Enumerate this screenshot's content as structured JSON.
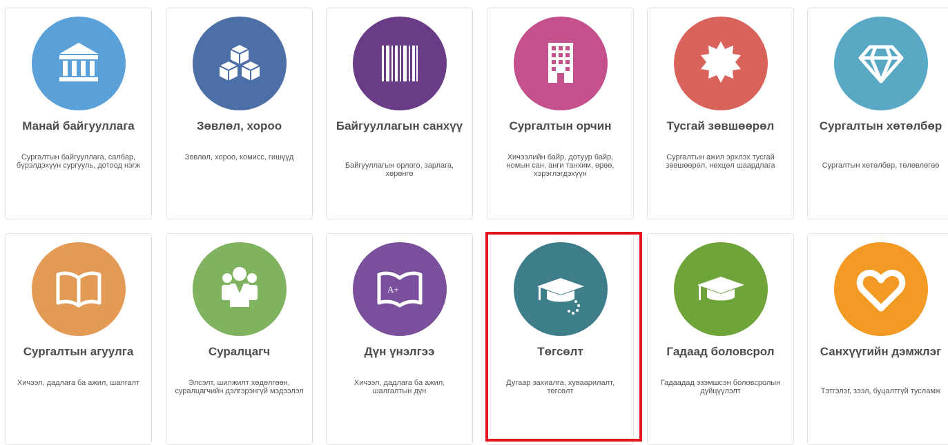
{
  "cards": [
    {
      "title": "Манай байгууллага",
      "desc": "Сургалтын байгууллага, салбар, бүрэлдэхүүн сургууль, дотоод нэгж",
      "icon": "bank-icon",
      "color": "#5aa1d9"
    },
    {
      "title": "Зөвлөл, хороо",
      "desc": "Зөвлөл, хороо, комисс, гишүүд",
      "icon": "cubes-icon",
      "color": "#4b6fa6"
    },
    {
      "title": "Байгууллагын санхүү",
      "desc": "Байгууллагын орлого, зарлага, хөрөнгө",
      "icon": "barcode-icon",
      "color": "#6a3b87"
    },
    {
      "title": "Сургалтын орчин",
      "desc": "Хичээлийн байр, дотуур байр, номын сан, анги танхим, өрөө, хэрэглэгдэхүүн",
      "icon": "building-icon",
      "color": "#c4508c"
    },
    {
      "title": "Тусгай зөвшөөрөл",
      "desc": "Сургалтын ажил эрхлэх тусгай зөвшөөрөл, нөхцөл шаардлага",
      "icon": "certificate-icon",
      "color": "#d9625a"
    },
    {
      "title": "Сургалтын хөтөлбөр",
      "desc": "Сургалтын хөтөлбөр, төлөвлөгөө",
      "icon": "diamond-icon",
      "color": "#5aa9c4"
    },
    {
      "title": "Сургалтын агуулга",
      "desc": "Хичээл, дадлага ба ажил, шалгалт",
      "icon": "book-icon",
      "color": "#e39a55"
    },
    {
      "title": "Суралцагч",
      "desc": "Элсэлт, шилжилт хөдөлгөөн, суралцагчийн дэлгэрэнгүй мэдээлэл",
      "icon": "users-icon",
      "color": "#7fb35f"
    },
    {
      "title": "Дүн үнэлгээ",
      "desc": "Хичээл, дадлага ба ажил, шалгалтын дүн",
      "icon": "grade-book-icon",
      "color": "#7a4f9c"
    },
    {
      "title": "Төгсөлт",
      "desc": "Дугаар захиалга, хуваарилалт, төгсөлт",
      "icon": "graduation-cap-icon",
      "color": "#3d7e8a"
    },
    {
      "title": "Гадаад боловсрол",
      "desc": "Гадаадад эзэмшсэн боловсролын дүйцүүлэлт",
      "icon": "mortarboard-icon",
      "color": "#6fa43a"
    },
    {
      "title": "Санхүүгийн дэмжлэг",
      "desc": "Тэтгэлэг, зээл, буцалтгүй тусламж",
      "icon": "heart-icon",
      "color": "#f39a24"
    }
  ]
}
